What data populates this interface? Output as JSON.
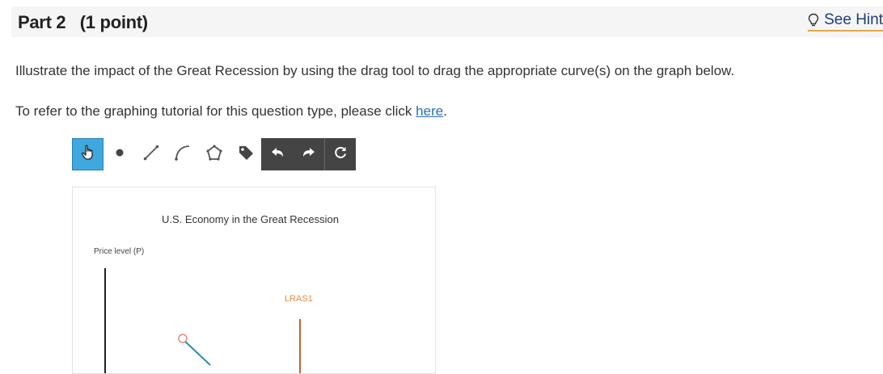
{
  "header": {
    "title": "Part 2   (1 point)",
    "hint_label": "See Hint"
  },
  "question": {
    "instructions": "Illustrate the impact of the Great Recession by using the drag tool to drag the appropriate curve(s) on the graph below.",
    "tutorial_prefix": "To refer to the graphing tutorial for this question type, please click ",
    "tutorial_link": "here",
    "tutorial_suffix": "."
  },
  "toolbar": {
    "tools": [
      {
        "name": "drag-tool",
        "icon": "pointing-hand-icon",
        "active": true
      },
      {
        "name": "point-tool",
        "icon": "dot-icon"
      },
      {
        "name": "line-tool",
        "icon": "line-icon"
      },
      {
        "name": "curve-tool",
        "icon": "curve-icon"
      },
      {
        "name": "polygon-tool",
        "icon": "pentagon-icon"
      },
      {
        "name": "label-tool",
        "icon": "tag-icon"
      },
      {
        "name": "undo-tool",
        "icon": "undo-icon"
      },
      {
        "name": "redo-tool",
        "icon": "redo-icon"
      },
      {
        "name": "reset-tool",
        "icon": "reset-icon"
      }
    ],
    "active_color": "#3fa8df"
  },
  "graph": {
    "title": "U.S. Economy in the Great Recession",
    "y_axis_label": "Price level (P)",
    "curve_label": "LRAS1",
    "curve_colors": {
      "lras": "#c0642a",
      "ad": "#2a8cb0"
    }
  }
}
